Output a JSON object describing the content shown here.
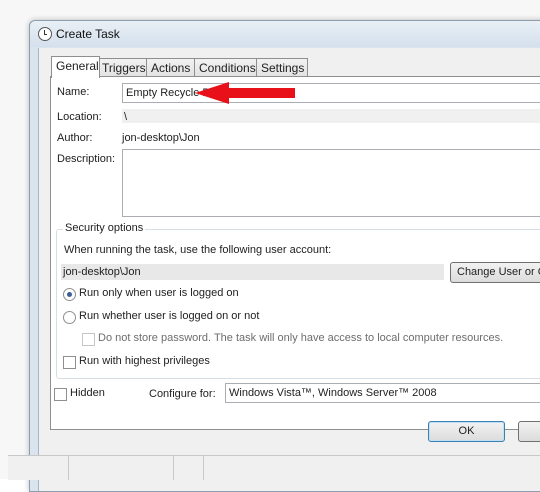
{
  "window": {
    "title": "Create Task"
  },
  "tabs": [
    "General",
    "Triggers",
    "Actions",
    "Conditions",
    "Settings"
  ],
  "general": {
    "name_label": "Name:",
    "name_value": "Empty Recycle Bin",
    "location_label": "Location:",
    "location_value": "\\",
    "author_label": "Author:",
    "author_value": "jon-desktop\\Jon",
    "description_label": "Description:",
    "description_value": ""
  },
  "security": {
    "title": "Security options",
    "account_prompt": "When running the task, use the following user account:",
    "account_value": "jon-desktop\\Jon",
    "change_button": "Change User or G",
    "radio_logged_on": "Run only when user is logged on",
    "radio_whether": "Run whether user is logged on or not",
    "do_not_store": "Do not store password.  The task will only have access to local computer resources.",
    "highest_privileges": "Run with highest privileges"
  },
  "hidden_label": "Hidden",
  "configure_label": "Configure for:",
  "configure_value": "Windows Vista™, Windows Server™ 2008",
  "buttons": {
    "ok": "OK"
  },
  "colors": {
    "annotation_arrow": "#e8111a",
    "default_button_border": "#3c7fb1"
  },
  "annotation": {
    "icon": "red-arrow-icon"
  }
}
